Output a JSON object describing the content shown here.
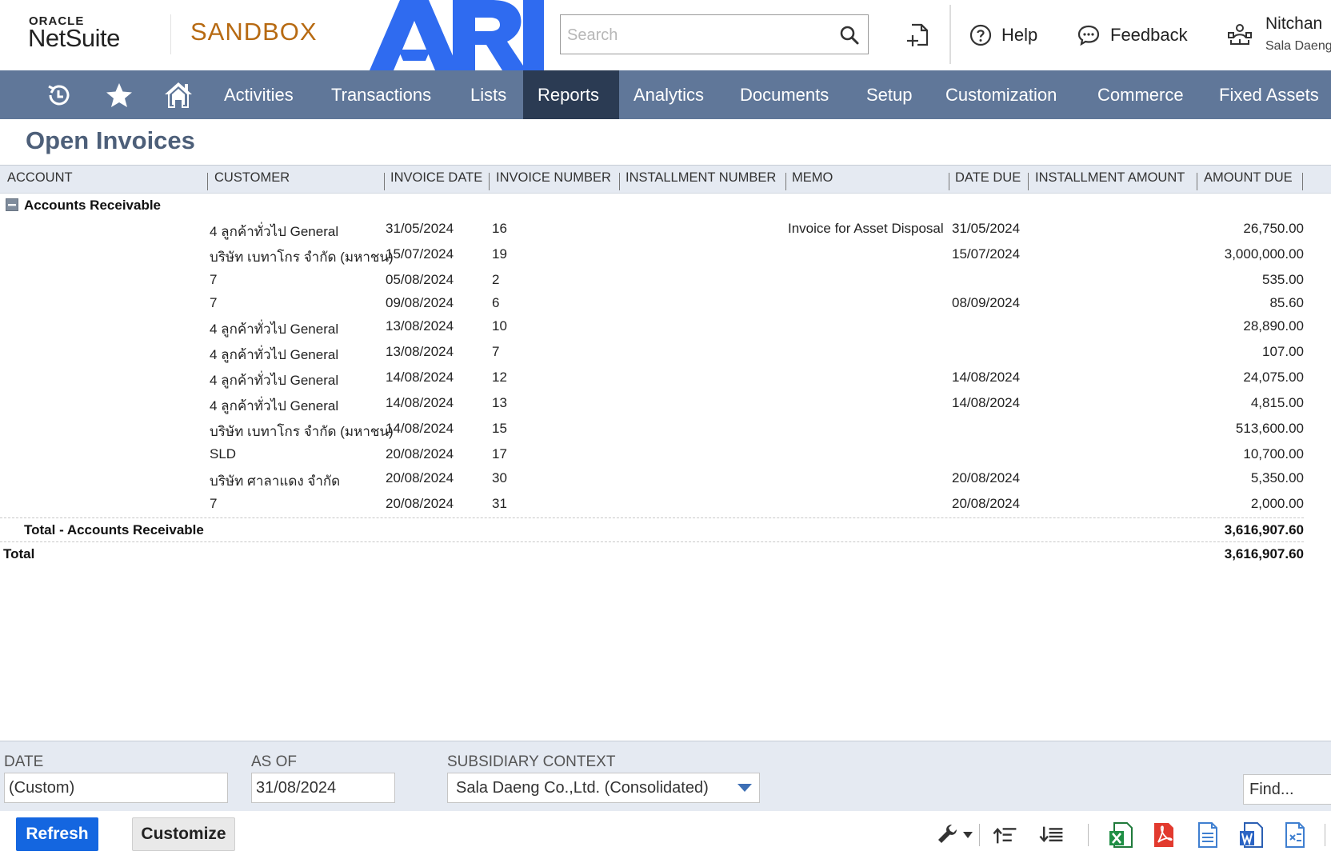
{
  "header": {
    "oracle_label": "ORACLE",
    "product_label": "NetSuite",
    "environment_label": "SANDBOX",
    "company_logo_text": "ARI",
    "search_placeholder": "Search",
    "help_label": "Help",
    "feedback_label": "Feedback",
    "user_name": "Nitchan",
    "user_company": "Sala Daeng"
  },
  "nav": {
    "items": [
      "Activities",
      "Transactions",
      "Lists",
      "Reports",
      "Analytics",
      "Documents",
      "Setup",
      "Customization",
      "Commerce",
      "Fixed Assets"
    ],
    "active": "Reports"
  },
  "page": {
    "title": "Open Invoices"
  },
  "report": {
    "columns": [
      "ACCOUNT",
      "CUSTOMER",
      "INVOICE DATE",
      "INVOICE NUMBER",
      "INSTALLMENT NUMBER",
      "MEMO",
      "DATE DUE",
      "INSTALLMENT AMOUNT",
      "AMOUNT DUE"
    ],
    "group": "Accounts Receivable",
    "rows": [
      {
        "customer": "4 ลูกค้าทั่วไป General",
        "invoice_date": "31/05/2024",
        "invoice_number": "16",
        "memo": "Invoice for Asset Disposal",
        "date_due": "31/05/2024",
        "amount_due": "26,750.00"
      },
      {
        "customer": "บริษัท เบทาโกร จำกัด (มหาชน)",
        "invoice_date": "15/07/2024",
        "invoice_number": "19",
        "memo": "",
        "date_due": "15/07/2024",
        "amount_due": "3,000,000.00"
      },
      {
        "customer": "7",
        "invoice_date": "05/08/2024",
        "invoice_number": "2",
        "memo": "",
        "date_due": "",
        "amount_due": "535.00"
      },
      {
        "customer": "7",
        "invoice_date": "09/08/2024",
        "invoice_number": "6",
        "memo": "",
        "date_due": "08/09/2024",
        "amount_due": "85.60"
      },
      {
        "customer": "4 ลูกค้าทั่วไป General",
        "invoice_date": "13/08/2024",
        "invoice_number": "10",
        "memo": "",
        "date_due": "",
        "amount_due": "28,890.00"
      },
      {
        "customer": "4 ลูกค้าทั่วไป General",
        "invoice_date": "13/08/2024",
        "invoice_number": "7",
        "memo": "",
        "date_due": "",
        "amount_due": "107.00"
      },
      {
        "customer": "4 ลูกค้าทั่วไป General",
        "invoice_date": "14/08/2024",
        "invoice_number": "12",
        "memo": "",
        "date_due": "14/08/2024",
        "amount_due": "24,075.00"
      },
      {
        "customer": "4 ลูกค้าทั่วไป General",
        "invoice_date": "14/08/2024",
        "invoice_number": "13",
        "memo": "",
        "date_due": "14/08/2024",
        "amount_due": "4,815.00"
      },
      {
        "customer": "บริษัท เบทาโกร จำกัด (มหาชน)",
        "invoice_date": "14/08/2024",
        "invoice_number": "15",
        "memo": "",
        "date_due": "",
        "amount_due": "513,600.00"
      },
      {
        "customer": "SLD",
        "invoice_date": "20/08/2024",
        "invoice_number": "17",
        "memo": "",
        "date_due": "",
        "amount_due": "10,700.00"
      },
      {
        "customer": "บริษัท ศาลาแดง จำกัด",
        "invoice_date": "20/08/2024",
        "invoice_number": "30",
        "memo": "",
        "date_due": "20/08/2024",
        "amount_due": "5,350.00"
      },
      {
        "customer": "7",
        "invoice_date": "20/08/2024",
        "invoice_number": "31",
        "memo": "",
        "date_due": "20/08/2024",
        "amount_due": "2,000.00"
      }
    ],
    "group_total_label": "Total - Accounts Receivable",
    "group_total": "3,616,907.60",
    "grand_total_label": "Total",
    "grand_total": "3,616,907.60"
  },
  "filters": {
    "date_label": "DATE",
    "date_value": "(Custom)",
    "as_of_label": "AS OF",
    "as_of_value": "31/08/2024",
    "subsidiary_label": "SUBSIDIARY CONTEXT",
    "subsidiary_value": "Sala Daeng Co.,Ltd. (Consolidated)",
    "find_placeholder": "Find..."
  },
  "actions": {
    "refresh_label": "Refresh",
    "customize_label": "Customize"
  },
  "colors": {
    "nav_bg": "#607799",
    "nav_active": "#2b3b53",
    "sandbox": "#b76a12",
    "ari_logo": "#2f6bf0",
    "primary_button": "#1466e0",
    "title": "#4d5f79"
  },
  "toolbar_icons": [
    "wrench-icon",
    "collapse-all-icon",
    "expand-all-icon",
    "excel-export-icon",
    "pdf-export-icon",
    "csv-export-icon",
    "word-export-icon",
    "print-icon"
  ]
}
